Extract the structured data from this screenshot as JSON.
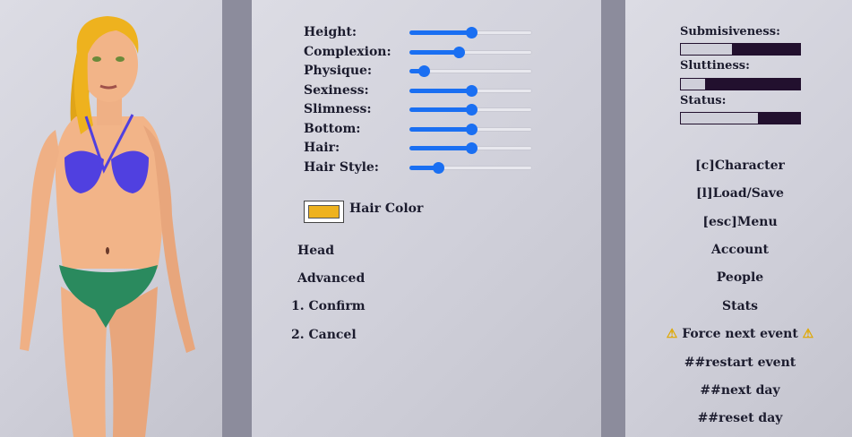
{
  "sliders": [
    {
      "label": "Height:",
      "value": 0.5
    },
    {
      "label": "Complexion:",
      "value": 0.4
    },
    {
      "label": "Physique:",
      "value": 0.12
    },
    {
      "label": "Sexiness:",
      "value": 0.5
    },
    {
      "label": "Slimness:",
      "value": 0.5
    },
    {
      "label": "Bottom:",
      "value": 0.5
    },
    {
      "label": "Hair:",
      "value": 0.5
    },
    {
      "label": "Hair Style:",
      "value": 0.23
    }
  ],
  "hair_color": {
    "label": "Hair Color",
    "color": "#eeb21e"
  },
  "menu": {
    "head": "Head",
    "advanced": "Advanced",
    "confirm": "1. Confirm",
    "cancel": "2. Cancel"
  },
  "stats": [
    {
      "label": "Submisiveness:",
      "value": 0.43
    },
    {
      "label": "Sluttiness:",
      "value": 0.2
    },
    {
      "label": "Status:",
      "value": 0.65
    }
  ],
  "actions": {
    "character": "[c]Character",
    "load_save": "[l]Load/Save",
    "menu": "[esc]Menu",
    "account": "Account",
    "people": "People",
    "stats": "Stats",
    "force_next_event": "Force next event",
    "restart_event": "##restart event",
    "next_day": "##next day",
    "reset_day": "##reset day"
  },
  "colors": {
    "slider_accent": "#1a6ff2",
    "stat_bar_dark": "#22102e",
    "hair": "#eeb21e",
    "bra": "#5040e0",
    "panties": "#2a8a5e",
    "skin": "#f2b488"
  }
}
